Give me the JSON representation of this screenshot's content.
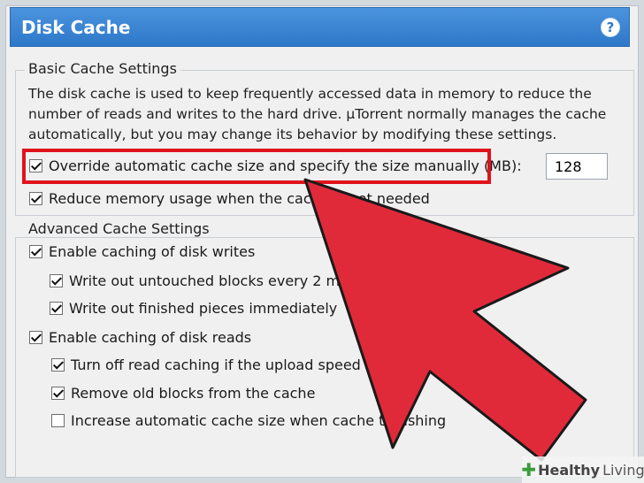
{
  "header": {
    "title": "Disk Cache",
    "help_icon": "help-icon"
  },
  "basic": {
    "title": "Basic Cache Settings",
    "description": "The disk cache is used to keep frequently accessed data in memory to reduce the number of reads and writes to the hard drive. µTorrent normally manages the cache automatically, but you may change its behavior by modifying these settings.",
    "override_label": "Override automatic cache size and specify the size manually (MB):",
    "override_checked": true,
    "cache_size_value": "128",
    "reduce_label": "Reduce memory usage when the cache is not needed",
    "reduce_checked": true
  },
  "advanced": {
    "title": "Advanced Cache Settings",
    "enable_writes_label": "Enable caching of disk writes",
    "untouched_label": "Write out untouched blocks every 2 minutes",
    "finished_label": "Write out finished pieces immediately",
    "enable_reads_label": "Enable caching of disk reads",
    "turn_off_label": "Turn off read caching if the upload speed is slow",
    "remove_old_label": "Remove old blocks from the cache",
    "increase_label": "Increase automatic cache size when cache thrashing"
  },
  "watermark": {
    "brand": "Healthy",
    "suffix": "Living"
  },
  "colors": {
    "header": "#3d87d6",
    "highlight": "#e0131b",
    "arrow": "#e02a3a"
  }
}
